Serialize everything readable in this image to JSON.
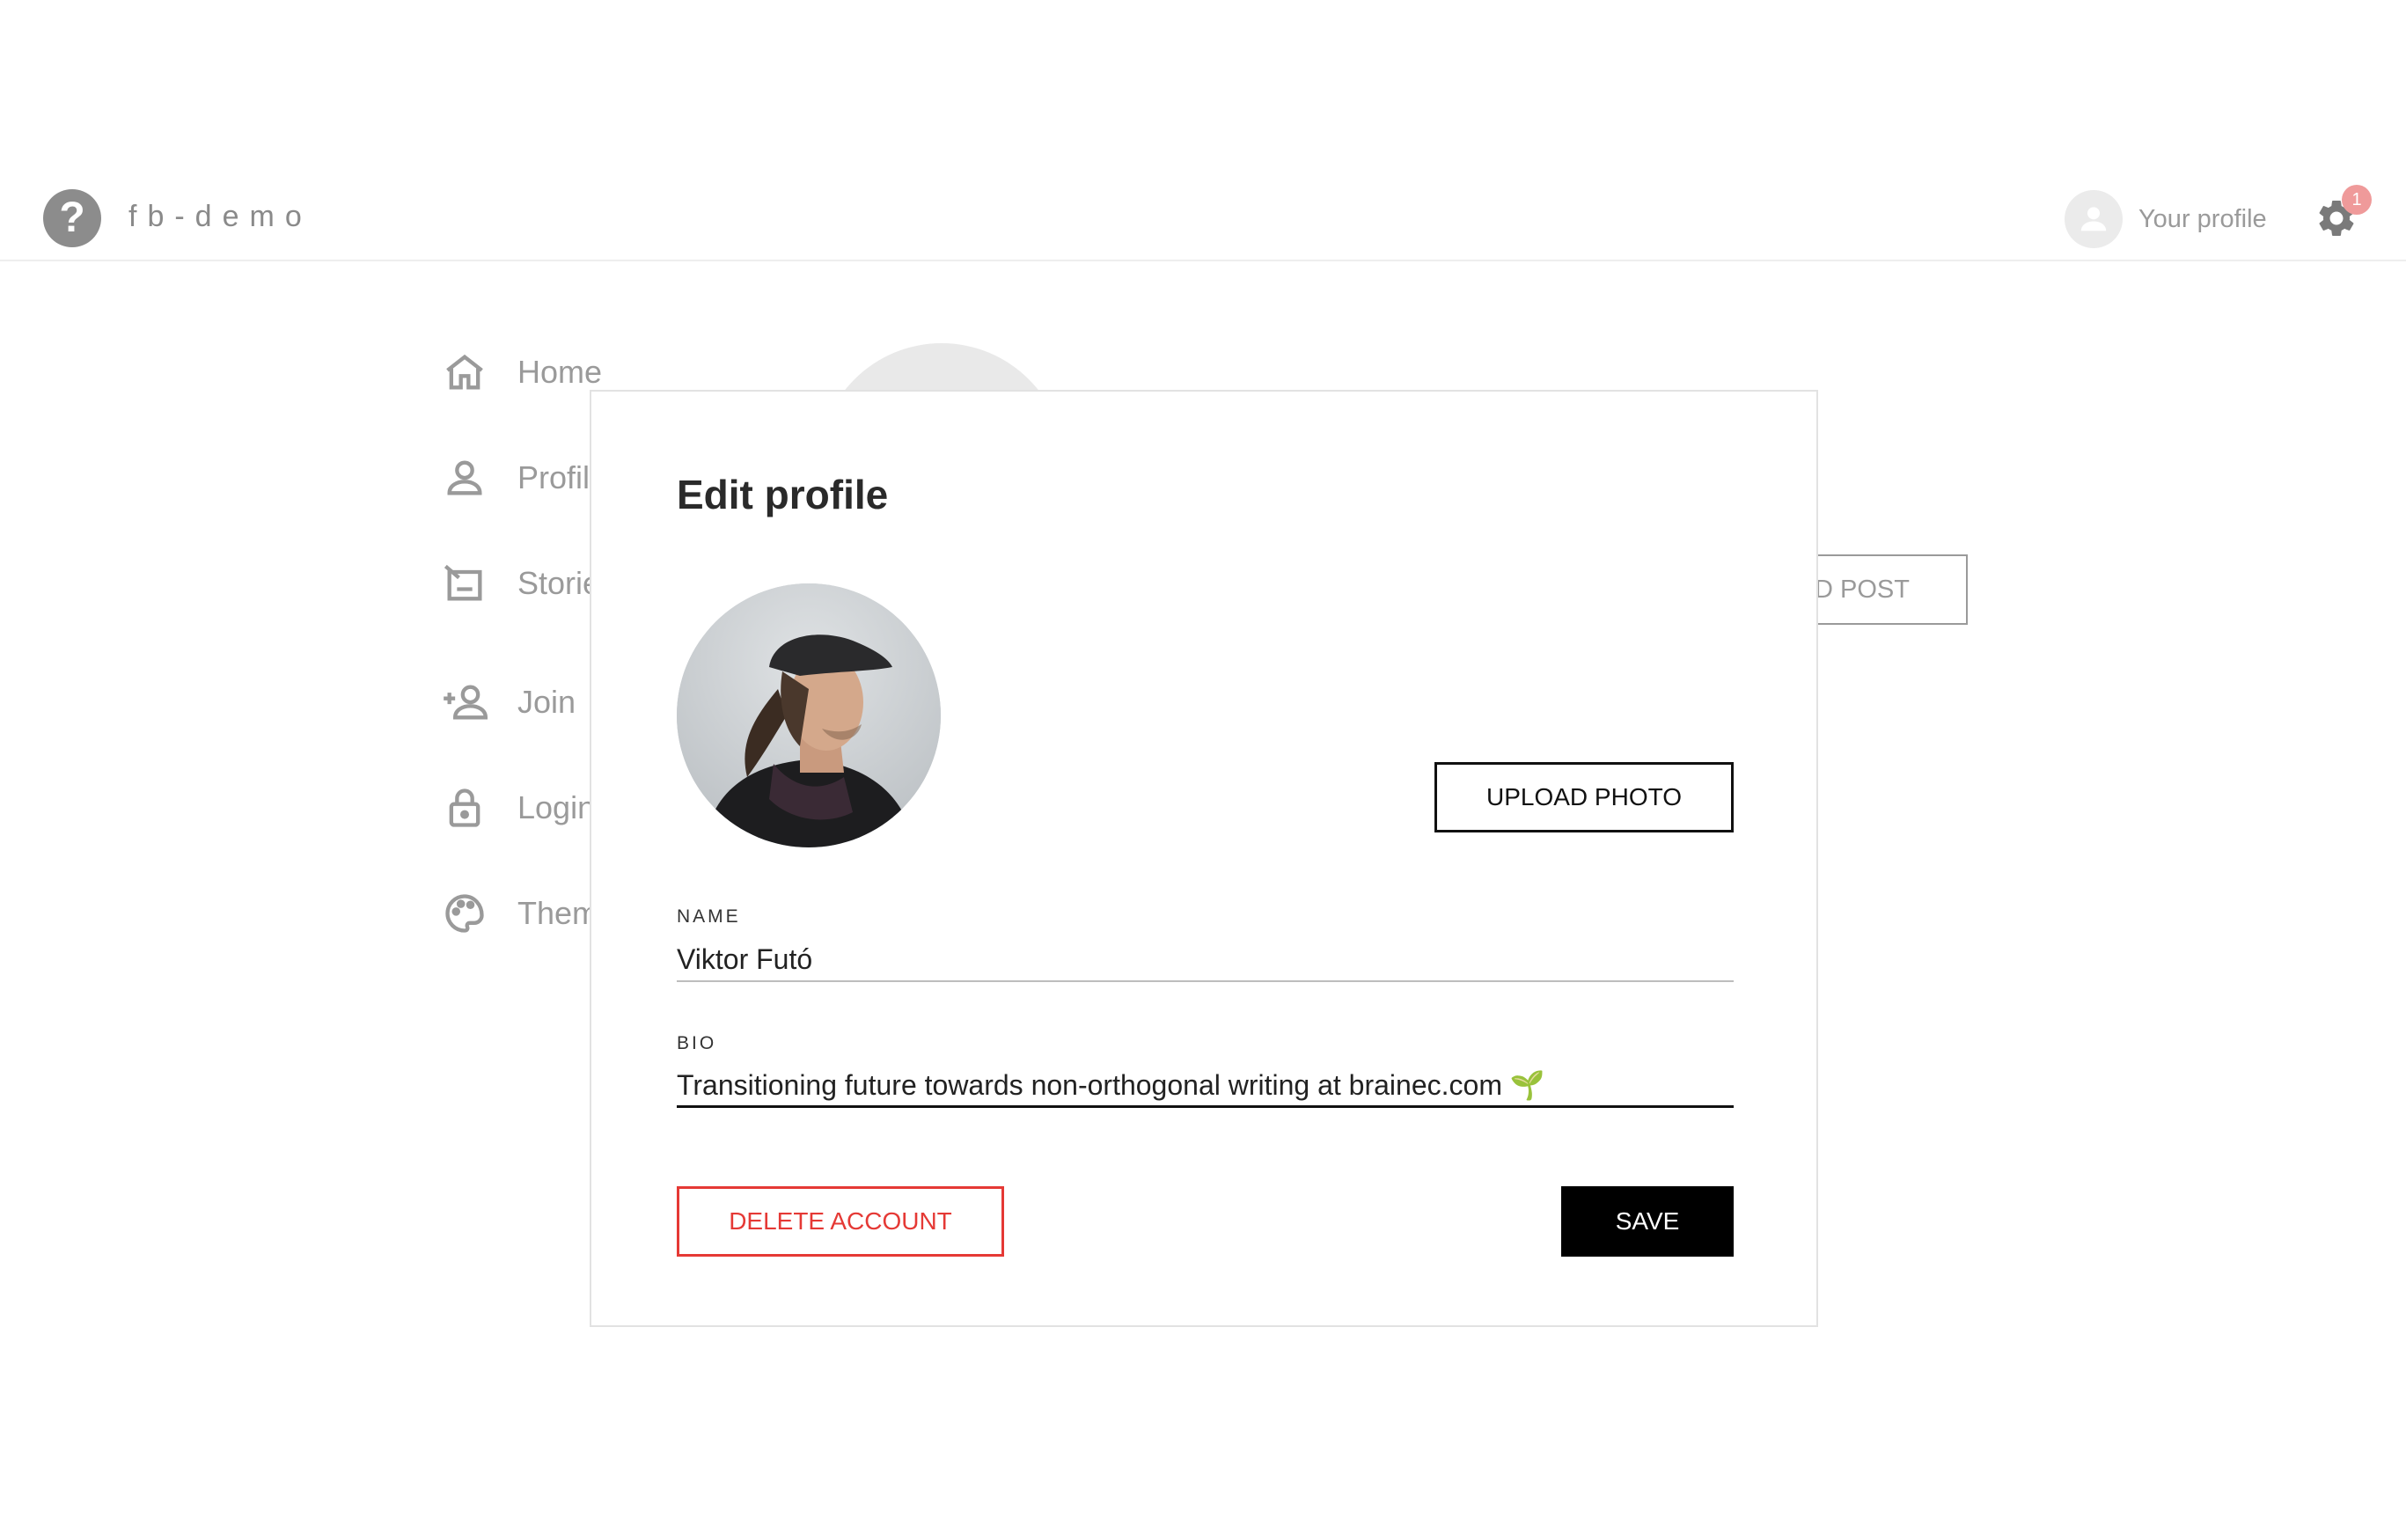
{
  "header": {
    "logo_icon": "help-circle-icon",
    "app_name": "fb-demo",
    "profile_label": "Your profile",
    "notification_count": "1"
  },
  "sidebar": {
    "items": [
      {
        "label": "Home",
        "icon": "home-icon"
      },
      {
        "label": "Profil",
        "icon": "person-icon"
      },
      {
        "label": "Storie",
        "icon": "stories-icon"
      },
      {
        "label": "Join",
        "icon": "person-add-icon"
      },
      {
        "label": "Login",
        "icon": "lock-icon"
      },
      {
        "label": "Them",
        "icon": "palette-icon"
      }
    ]
  },
  "background": {
    "post_button_label": "DD POST"
  },
  "modal": {
    "title": "Edit profile",
    "upload_label": "UPLOAD PHOTO",
    "name_label": "NAME",
    "name_value": "Viktor Futó",
    "bio_label": "BIO",
    "bio_value": "Transitioning future towards non-orthogonal writing at brainec.com 🌱",
    "delete_label": "DELETE ACCOUNT",
    "save_label": "SAVE"
  },
  "colors": {
    "danger": "#e53935",
    "primary": "#000000",
    "badge": "#ef9a9a",
    "muted": "#9a9a9a"
  }
}
